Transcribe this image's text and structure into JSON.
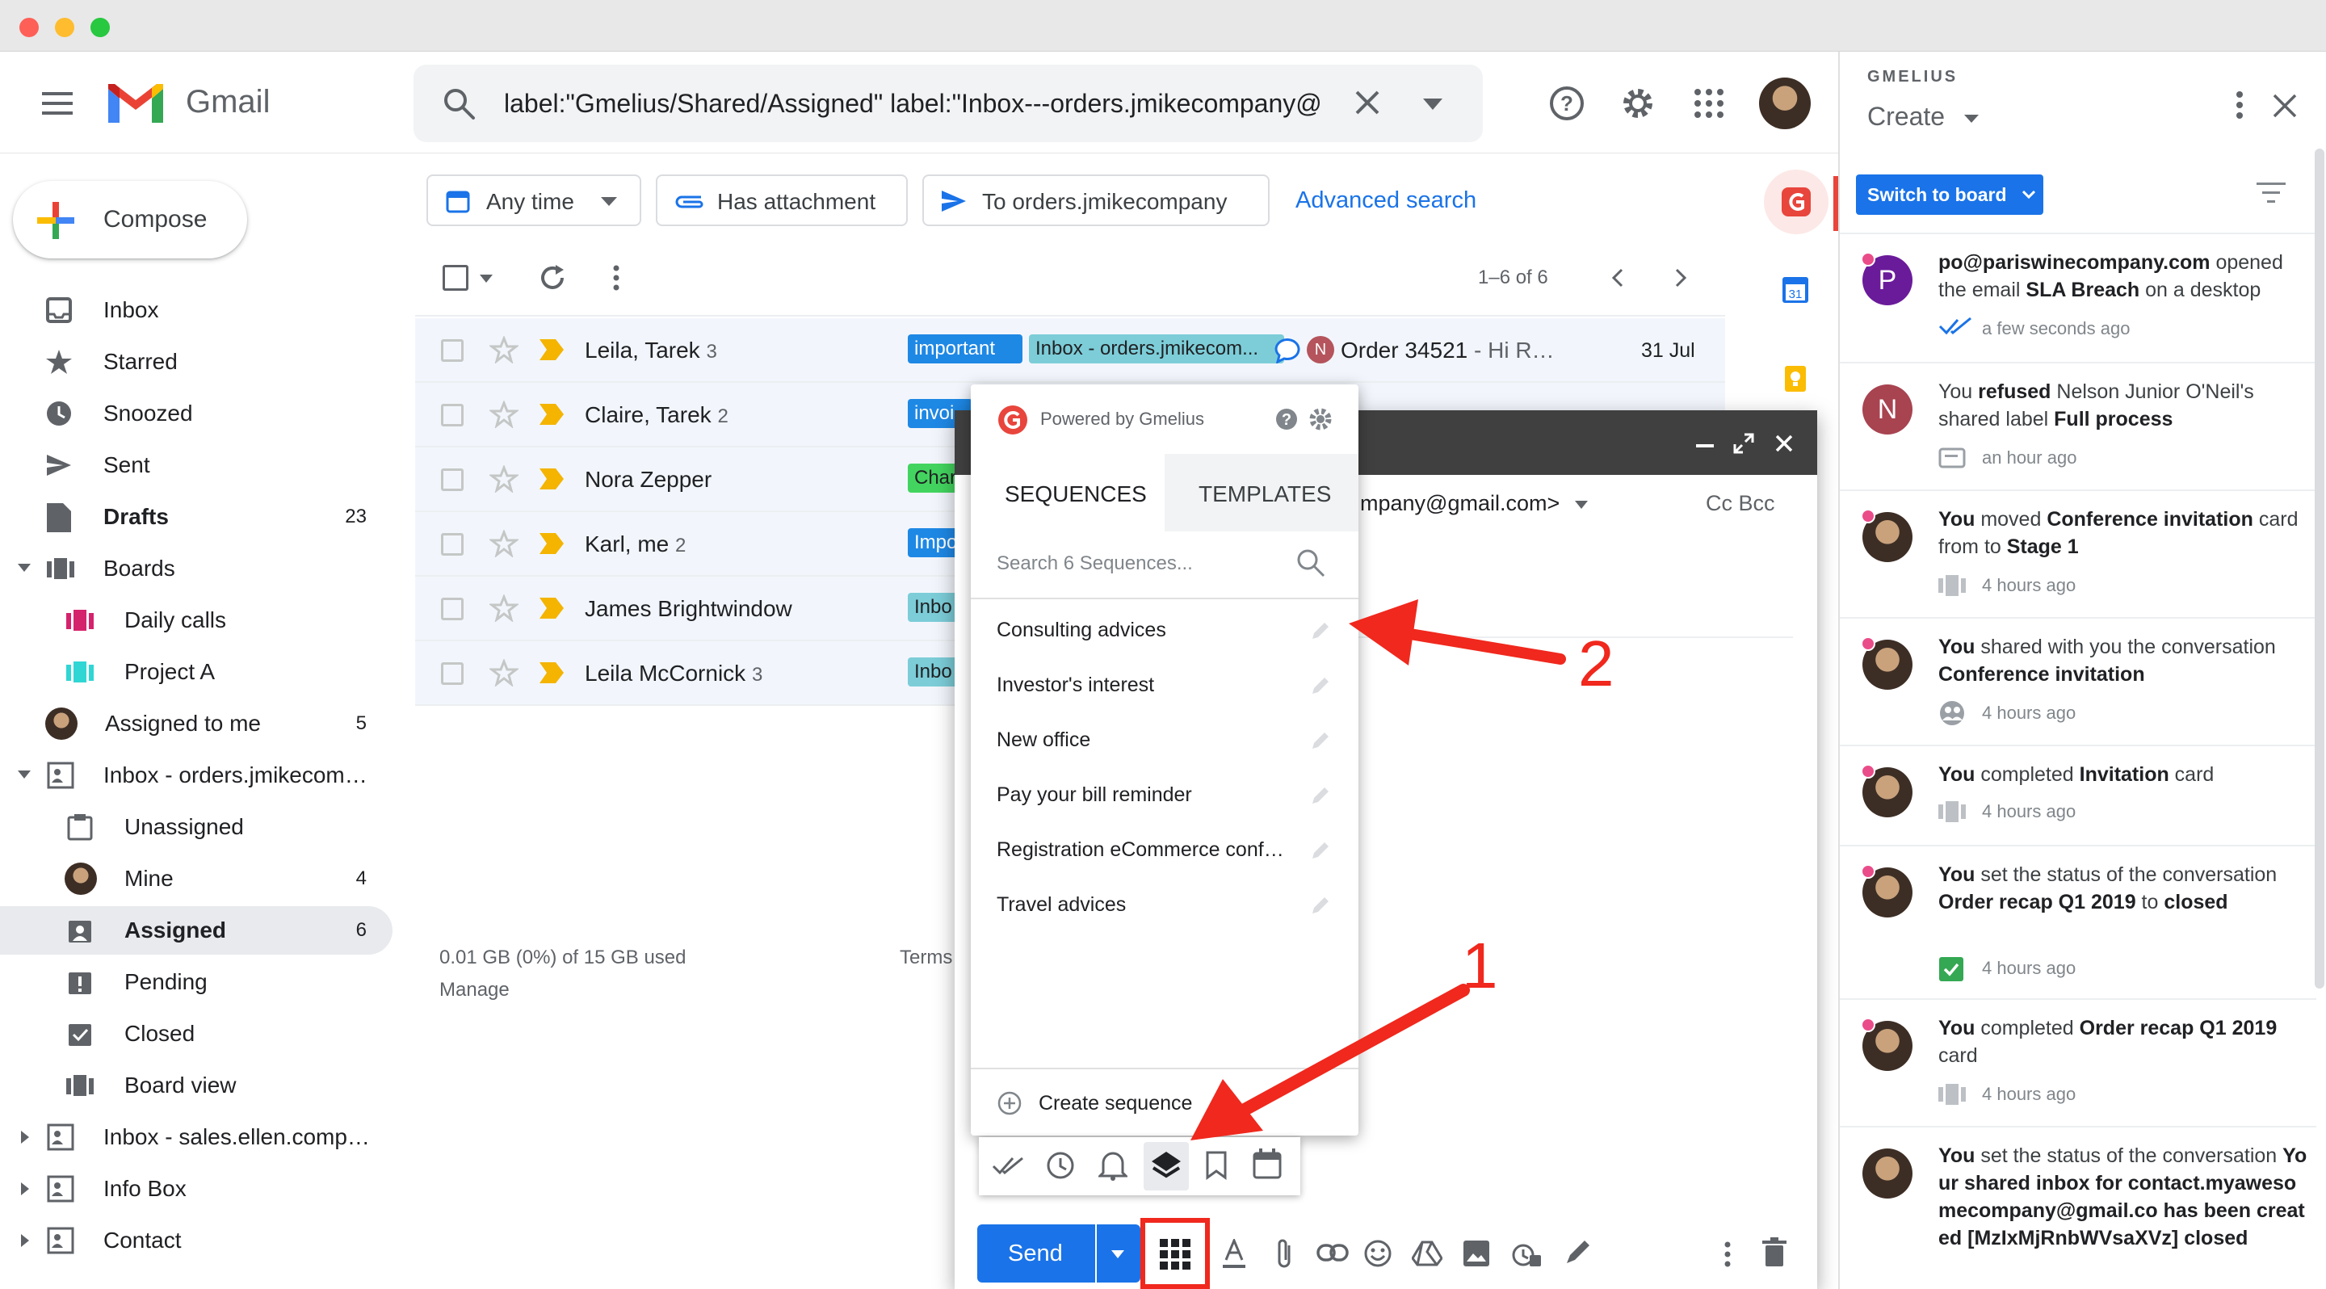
{
  "header": {
    "product": "Gmail",
    "search_query": "label:\"Gmelius/Shared/Assigned\" label:\"Inbox---orders.jmikecompany@"
  },
  "compose_label": "Compose",
  "nav": [
    {
      "label": "Inbox",
      "count": ""
    },
    {
      "label": "Starred",
      "count": ""
    },
    {
      "label": "Snoozed",
      "count": ""
    },
    {
      "label": "Sent",
      "count": ""
    },
    {
      "label": "Drafts",
      "count": "23"
    },
    {
      "label": "Boards",
      "count": ""
    },
    {
      "label": "Daily calls",
      "count": ""
    },
    {
      "label": "Project A",
      "count": ""
    },
    {
      "label": "Assigned to me",
      "count": "5"
    },
    {
      "label": "Inbox - orders.jmikecom…",
      "count": ""
    },
    {
      "label": "Unassigned",
      "count": ""
    },
    {
      "label": "Mine",
      "count": "4"
    },
    {
      "label": "Assigned",
      "count": "6"
    },
    {
      "label": "Pending",
      "count": ""
    },
    {
      "label": "Closed",
      "count": ""
    },
    {
      "label": "Board view",
      "count": ""
    },
    {
      "label": "Inbox - sales.ellen.comp…",
      "count": ""
    },
    {
      "label": "Info Box",
      "count": ""
    },
    {
      "label": "Contact",
      "count": ""
    }
  ],
  "filters": {
    "any_time": "Any time",
    "has_attachment": "Has attachment",
    "to": "To orders.jmikecompany",
    "advanced": "Advanced search"
  },
  "pagination": "1–6 of 6",
  "emails": [
    {
      "sender": "Leila, Tarek",
      "count": "3",
      "tags": [
        "important",
        "Inbox - orders.jmikecom..."
      ],
      "subject": "Order 34521",
      "snippet": " - Hi R…",
      "date": "31 Jul"
    },
    {
      "sender": "Claire, Tarek",
      "count": "2",
      "tags": [
        "invoi"
      ],
      "subject": "",
      "snippet": "",
      "date": ""
    },
    {
      "sender": "Nora Zepper",
      "count": "",
      "tags": [
        "Char"
      ],
      "subject": "",
      "snippet": "",
      "date": ""
    },
    {
      "sender": "Karl, me",
      "count": "2",
      "tags": [
        "Impo"
      ],
      "subject": "",
      "snippet": "",
      "date": ""
    },
    {
      "sender": "James Brightwindow",
      "count": "",
      "tags": [
        "Inbo"
      ],
      "subject": "",
      "snippet": "",
      "date": ""
    },
    {
      "sender": "Leila McCornick",
      "count": "3",
      "tags": [
        "Inbo"
      ],
      "subject": "",
      "snippet": "",
      "date": ""
    }
  ],
  "avatar_initial_row1": "N",
  "footer": {
    "storage": "0.01 GB (0%) of 15 GB used",
    "manage": "Manage",
    "terms": "Terms"
  },
  "compose_window": {
    "from": "mpany@gmail.com>",
    "cc_bcc": "Cc Bcc",
    "send": "Send"
  },
  "gmelius_popup": {
    "powered": "Powered by Gmelius",
    "tab_sequences": "SEQUENCES",
    "tab_templates": "TEMPLATES",
    "search_placeholder": "Search 6 Sequences...",
    "sequences": [
      "Consulting advices",
      "Investor's interest",
      "New office",
      "Pay your bill reminder",
      "Registration eCommerce conf…",
      "Travel advices"
    ],
    "create": "Create sequence"
  },
  "annotations": {
    "one": "1",
    "two": "2"
  },
  "right_panel": {
    "brand": "GMELIUS",
    "create": "Create",
    "switch_board": "Switch to board",
    "activities": [
      {
        "initial": "P",
        "html_parts": [
          "po@pariswinecompany.com",
          " opened the email ",
          "SLA Breach",
          " on a desktop"
        ],
        "time": "a few seconds ago"
      },
      {
        "initial": "N",
        "html_parts": [
          "You ",
          "refused",
          " Nelson Junior O'Neil's shared label ",
          "Full process"
        ],
        "time": "an hour ago"
      },
      {
        "initial": "",
        "html_parts": [
          "You",
          " moved ",
          "Conference invitation",
          " card from to ",
          "Stage 1"
        ],
        "time": "4 hours ago"
      },
      {
        "initial": "",
        "html_parts": [
          "You",
          " shared with you the conversation ",
          "Conference invitation"
        ],
        "time": "4 hours ago"
      },
      {
        "initial": "",
        "html_parts": [
          "You",
          " completed ",
          "Invitation",
          " card"
        ],
        "time": "4 hours ago"
      },
      {
        "initial": "",
        "html_parts": [
          "You",
          " set the status of the conversation ",
          "Order recap Q1 2019",
          " to ",
          "closed"
        ],
        "time": "4 hours ago"
      },
      {
        "initial": "",
        "html_parts": [
          "You",
          " completed ",
          "Order recap Q1 2019",
          " card"
        ],
        "time": "4 hours ago"
      },
      {
        "initial": "",
        "html_parts": [
          "You",
          " set the status of the conversation ",
          "Your shared inbox for contact.myawesomecompany@gmail.co has been created [MzIxMjRnbWVsaXVz]",
          " ",
          "closed"
        ],
        "time": ""
      }
    ]
  },
  "colors": {
    "gmail_red": "#ea4335",
    "primary_blue": "#1a73e8",
    "annotation_red": "#f0281d",
    "gmelius_red": "#e8453c"
  }
}
